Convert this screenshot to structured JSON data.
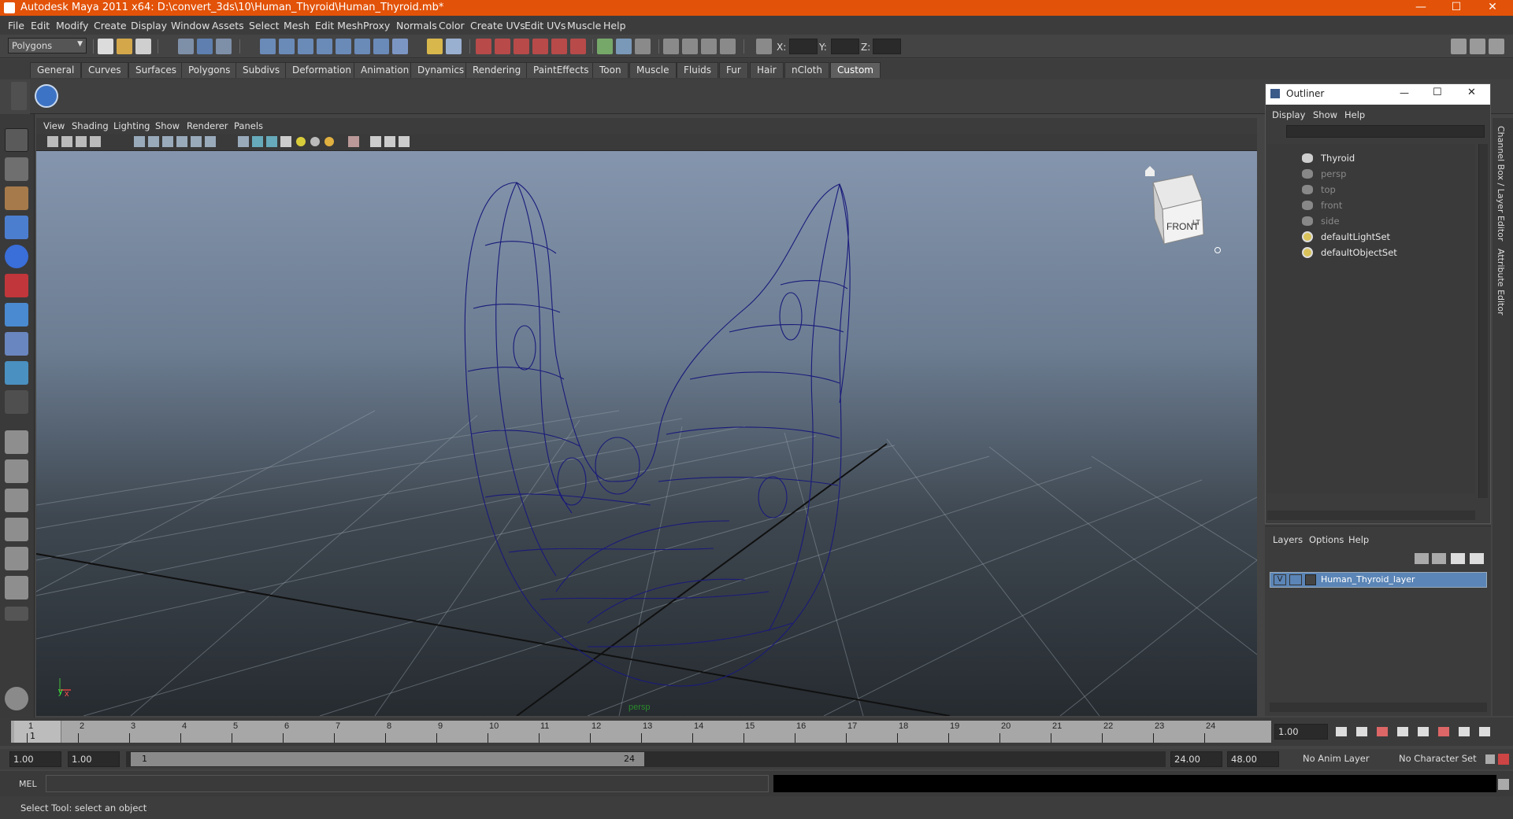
{
  "window": {
    "title": "Autodesk Maya 2011 x64: D:\\convert_3ds\\10\\Human_Thyroid\\Human_Thyroid.mb*",
    "minimize": "—",
    "maximize": "☐",
    "close": "✕"
  },
  "menu": [
    "File",
    "Edit",
    "Modify",
    "Create",
    "Display",
    "Window",
    "Assets",
    "Select",
    "Mesh",
    "Edit Mesh",
    "Proxy",
    "Normals",
    "Color",
    "Create UVs",
    "Edit UVs",
    "Muscle",
    "Help"
  ],
  "statusline": {
    "mode_selector": "Polygons",
    "x_label": "X:",
    "y_label": "Y:",
    "z_label": "Z:"
  },
  "shelf_tabs": [
    "General",
    "Curves",
    "Surfaces",
    "Polygons",
    "Subdivs",
    "Deformation",
    "Animation",
    "Dynamics",
    "Rendering",
    "PaintEffects",
    "Toon",
    "Muscle",
    "Fluids",
    "Fur",
    "Hair",
    "nCloth",
    "Custom"
  ],
  "active_shelf_tab": "Custom",
  "viewport": {
    "menu": [
      "View",
      "Shading",
      "Lighting",
      "Show",
      "Renderer",
      "Panels"
    ],
    "camera_label": "persp",
    "viewcube_label": "FRONT",
    "viewcube_side": "LT",
    "axis_y": "y",
    "axis_x": "x"
  },
  "outliner": {
    "title": "Outliner",
    "menu": [
      "Display",
      "Show",
      "Help"
    ],
    "items": [
      {
        "label": "Thyroid",
        "dim": false
      },
      {
        "label": "persp",
        "dim": true
      },
      {
        "label": "top",
        "dim": true
      },
      {
        "label": "front",
        "dim": true
      },
      {
        "label": "side",
        "dim": true
      },
      {
        "label": "defaultLightSet",
        "dim": false
      },
      {
        "label": "defaultObjectSet",
        "dim": false
      }
    ]
  },
  "layers": {
    "menu": [
      "Layers",
      "Options",
      "Help"
    ],
    "layer_visible": "V",
    "layer_name": "Human_Thyroid_layer"
  },
  "side_tabs": {
    "channel_box": "Channel Box / Layer Editor",
    "attribute_editor": "Attribute Editor"
  },
  "timeline": {
    "ticks": [
      "1",
      "2",
      "3",
      "4",
      "5",
      "6",
      "7",
      "8",
      "9",
      "10",
      "11",
      "12",
      "13",
      "14",
      "15",
      "16",
      "17",
      "18",
      "19",
      "20",
      "21",
      "22",
      "23",
      "24"
    ],
    "current_frame_marker": "1",
    "current_time": "1.00"
  },
  "range": {
    "start": "1.00",
    "playback_start": "1.00",
    "slider_start": "1",
    "slider_end": "24",
    "playback_end": "24.00",
    "end": "48.00",
    "anim_layer": "No Anim Layer",
    "character_set": "No Character Set"
  },
  "cmdline": {
    "label": "MEL"
  },
  "help": {
    "text": "Select Tool: select an object"
  },
  "colors": {
    "title_bar": "#e25208",
    "wire": "#1a1a7a",
    "layer_highlight": "#5b85b6"
  }
}
